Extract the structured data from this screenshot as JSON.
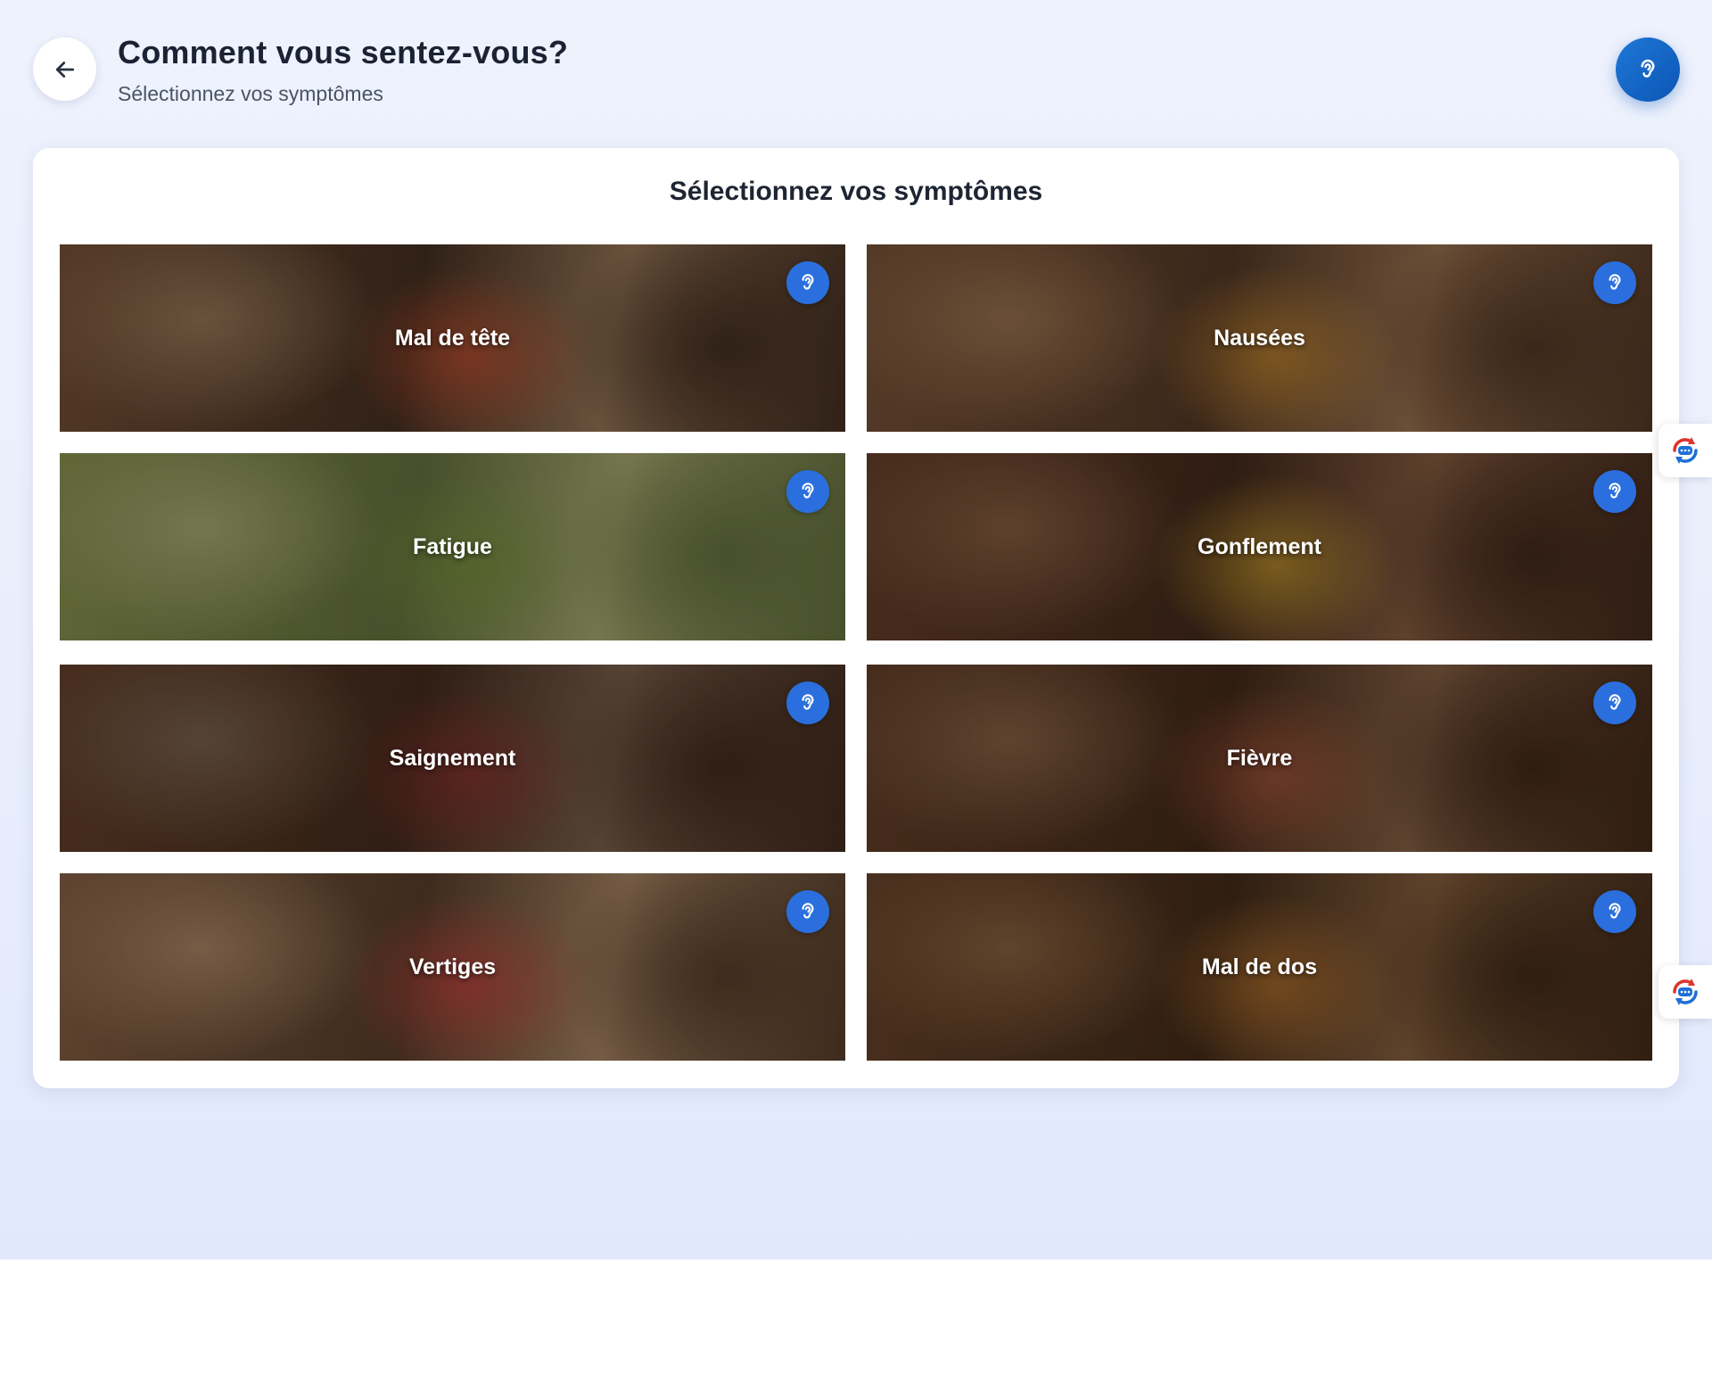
{
  "header": {
    "title": "Comment vous sentez-vous?",
    "subtitle": "Sélectionnez vos symptômes"
  },
  "card": {
    "title": "Sélectionnez vos symptômes"
  },
  "symptoms": [
    {
      "label": "Mal de tête",
      "palette": [
        "#6b4a32",
        "#3b2a1e",
        "#8a6e52"
      ],
      "accent": "#c44a2a"
    },
    {
      "label": "Nausées",
      "palette": [
        "#6e4c34",
        "#4a3322",
        "#8c6a4a"
      ],
      "accent": "#c68a2a"
    },
    {
      "label": "Fatigue",
      "palette": [
        "#7d8a4a",
        "#5b6b3a",
        "#9aa06a"
      ],
      "accent": "#6b8a34"
    },
    {
      "label": "Gonflement",
      "palette": [
        "#5c3a26",
        "#3a2418",
        "#7a563c"
      ],
      "accent": "#c8a028"
    },
    {
      "label": "Saignement",
      "palette": [
        "#5a3a26",
        "#3a261a",
        "#6e5a48"
      ],
      "accent": "#8a2a2a"
    },
    {
      "label": "Fièvre",
      "palette": [
        "#5a3a24",
        "#3a2416",
        "#7a5a40"
      ],
      "accent": "#a8543a"
    },
    {
      "label": "Vertiges",
      "palette": [
        "#7a5a40",
        "#4e3826",
        "#9a7c5e"
      ],
      "accent": "#c43a3a"
    },
    {
      "label": "Mal de dos",
      "palette": [
        "#5e3e26",
        "#3a2616",
        "#7c5a3a"
      ],
      "accent": "#b8742a"
    }
  ],
  "colors": {
    "brand_blue": "#2a6fdd",
    "side_tool_red": "#e0342c",
    "side_tool_blue": "#1f6fd6"
  },
  "icons": {
    "back": "arrow-left-icon",
    "audio": "ear-icon",
    "side_tool": "translate-chat-icon"
  }
}
